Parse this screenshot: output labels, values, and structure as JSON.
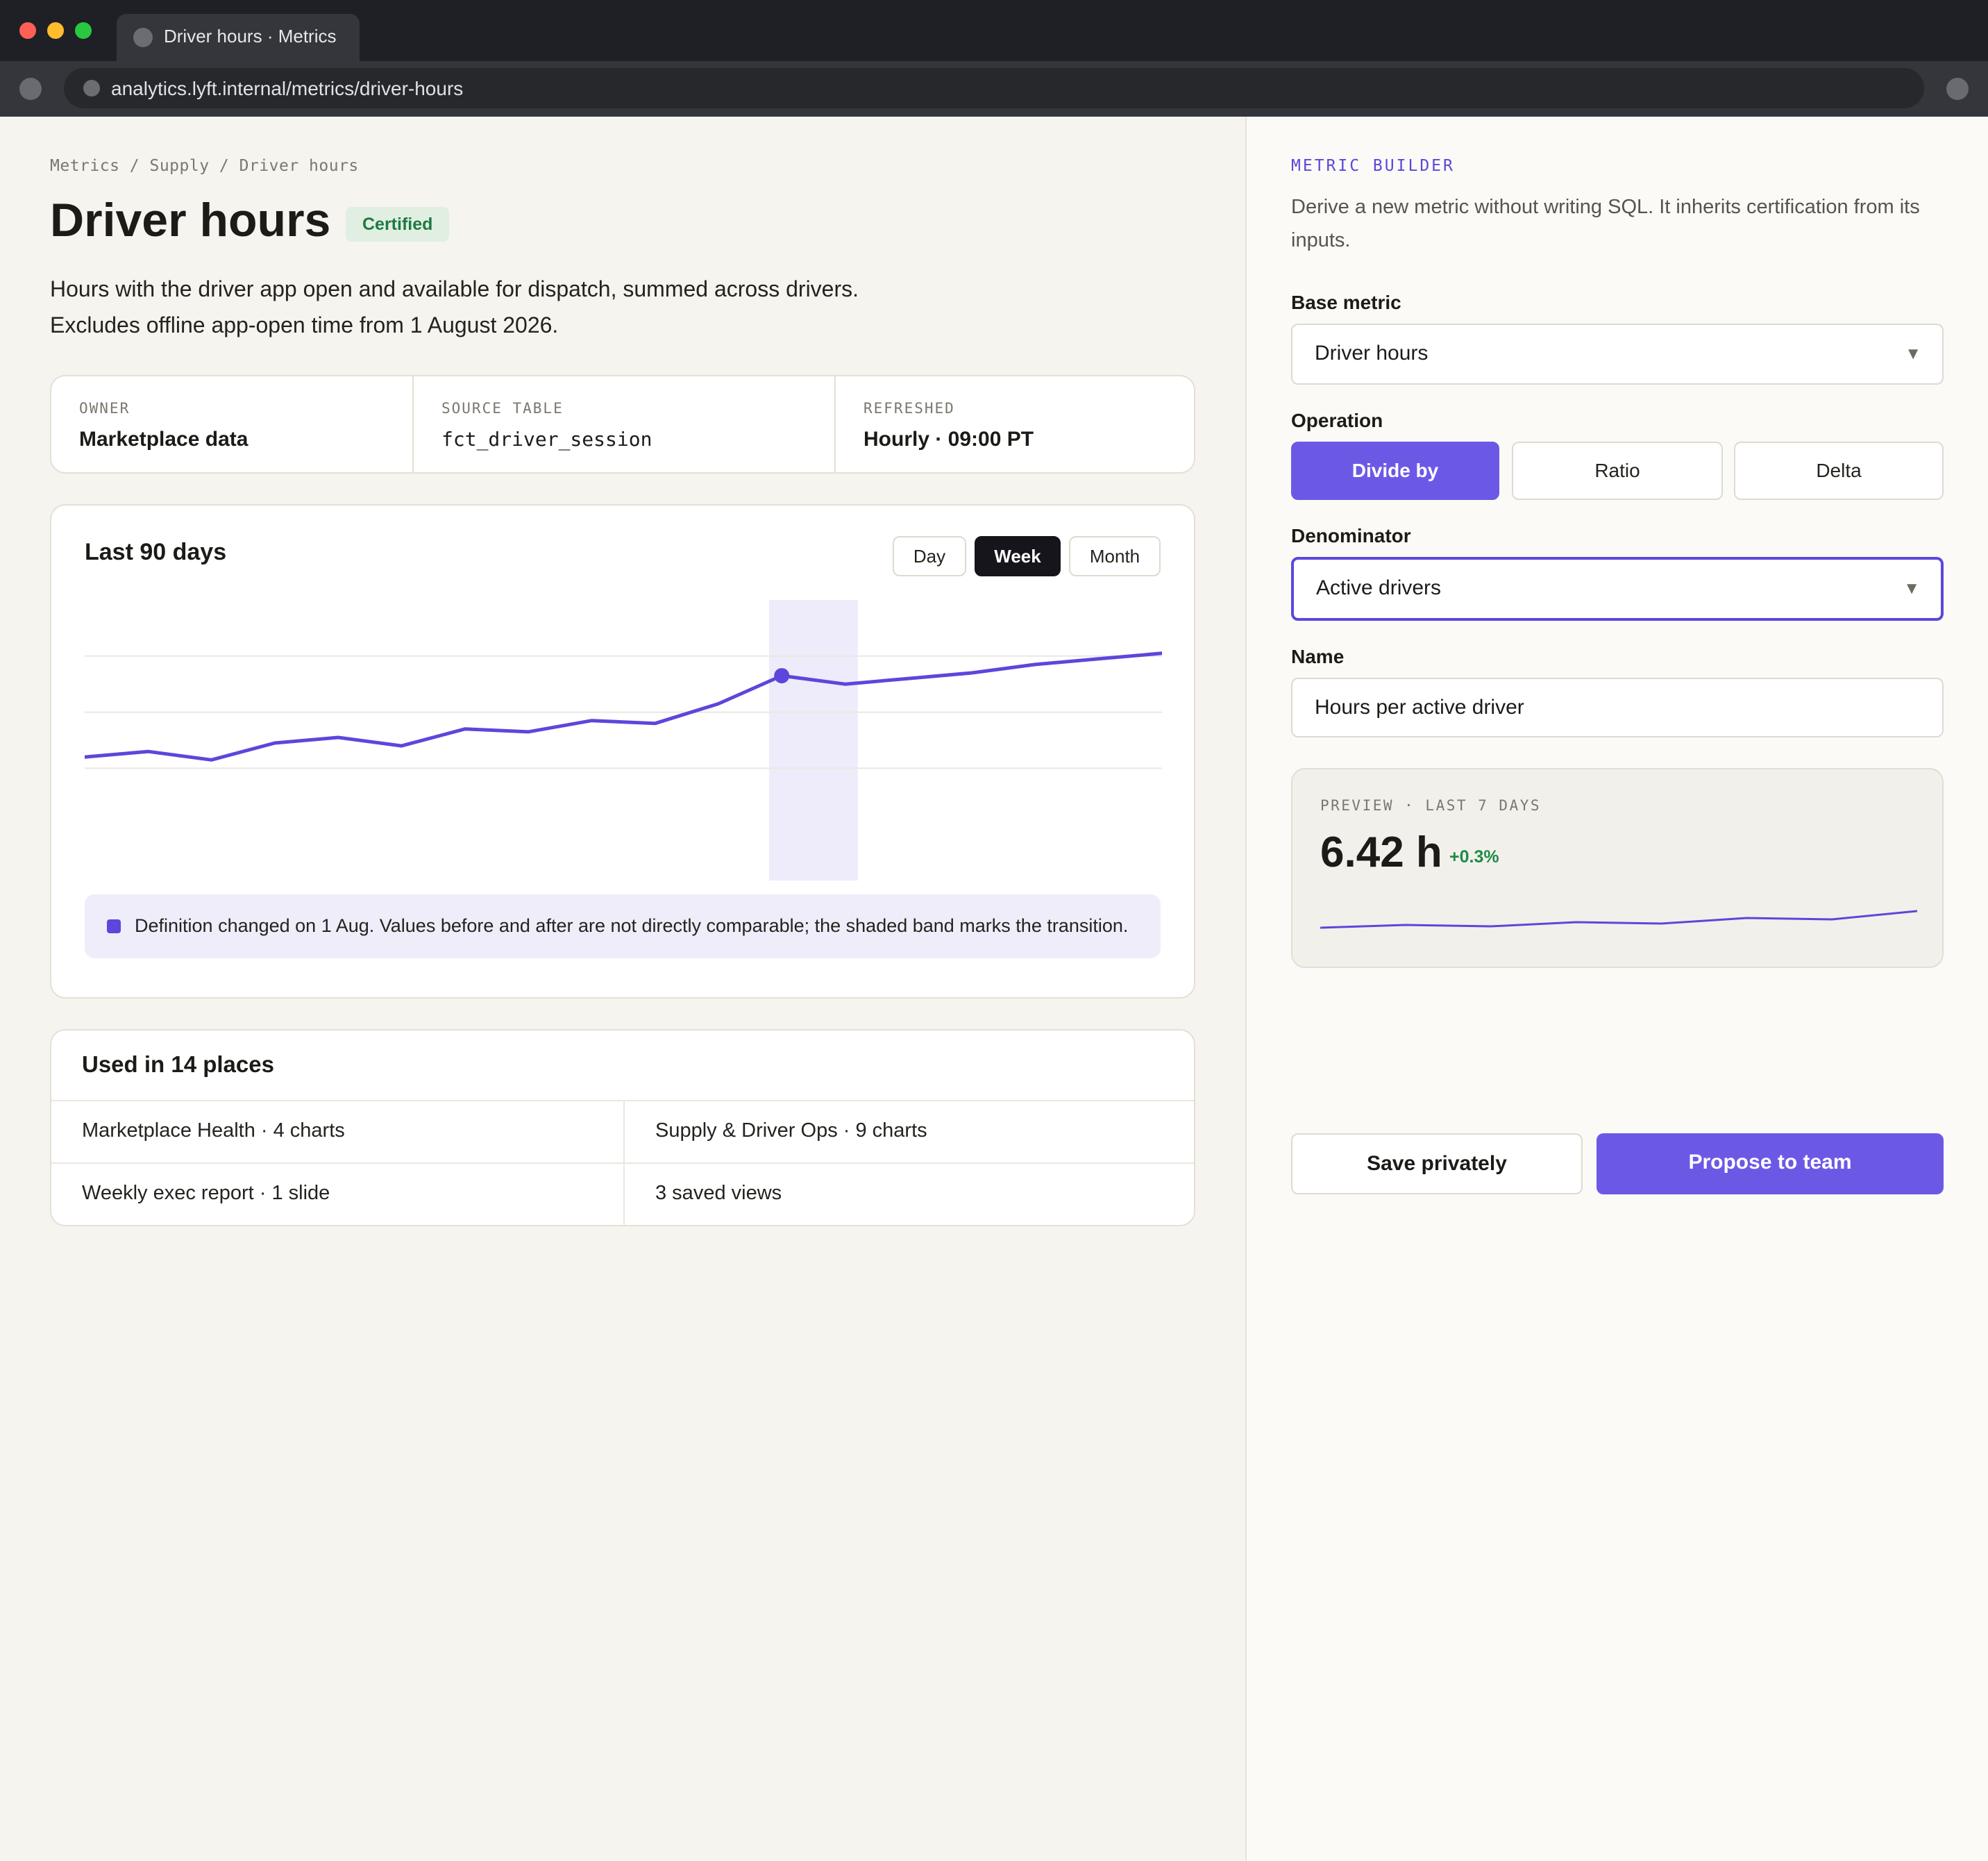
{
  "browser": {
    "tab_title": "Driver hours · Metrics",
    "url": "analytics.lyft.internal/metrics/driver-hours"
  },
  "metric": {
    "breadcrumb": "Metrics / Supply / Driver hours",
    "title": "Driver hours",
    "badge": "Certified",
    "description_lines": [
      "Hours with the driver app open and available for dispatch, summed across drivers.",
      "Excludes offline app-open time from 1 August 2026."
    ]
  },
  "meta": [
    {
      "label": "OWNER",
      "value": "Marketplace data"
    },
    {
      "label": "SOURCE TABLE",
      "value": "fct_driver_session"
    },
    {
      "label": "REFRESHED",
      "value": "Hourly · 09:00 PT"
    }
  ],
  "chart": {
    "title": "Last 90 days",
    "granularity_options": [
      "Day",
      "Week",
      "Month"
    ],
    "selected_granularity": "Week",
    "note": "Definition changed on 1 Aug. Values before and after are not directly comparable; the shaded band marks the transition.",
    "colors": {
      "line": "#5b47dc",
      "band": "#eeebfa",
      "grid": "#ebe8e2"
    }
  },
  "chart_data": {
    "type": "line",
    "title": "Last 90 days",
    "xlabel": "",
    "ylabel": "",
    "x": [
      0,
      1,
      2,
      3,
      4,
      5,
      6,
      7,
      8,
      9,
      10,
      11,
      12,
      13,
      14,
      15,
      16,
      17
    ],
    "values": [
      22,
      23,
      21.5,
      24.5,
      25.5,
      24,
      27,
      26.5,
      28.5,
      28,
      31.5,
      36.5,
      35,
      36,
      37,
      38.5,
      39.5,
      40.5
    ],
    "ylim": [
      0,
      50
    ],
    "highlight_band": [
      10.8,
      12.2
    ],
    "highlight_point_index": 11,
    "grid": true,
    "gridlines": [
      20,
      30,
      40
    ]
  },
  "usage": {
    "title": "Used in 14 places",
    "items": [
      "Marketplace Health · 4 charts",
      "Supply & Driver Ops · 9 charts",
      "Weekly exec report · 1 slide",
      "3 saved views"
    ]
  },
  "builder": {
    "eyebrow": "METRIC BUILDER",
    "description": "Derive a new metric without writing SQL. It inherits certification from its inputs.",
    "base_metric_label": "Base metric",
    "base_metric_value": "Driver hours",
    "operation_label": "Operation",
    "operations": [
      "Divide by",
      "Ratio",
      "Delta"
    ],
    "selected_operation": "Divide by",
    "denominator_label": "Denominator",
    "denominator_value": "Active drivers",
    "name_label": "Name",
    "name_value": "Hours per active driver",
    "preview": {
      "label": "PREVIEW · LAST 7 DAYS",
      "value": "6.42 h",
      "delta": "+0.3%",
      "spark": [
        6.36,
        6.37,
        6.365,
        6.38,
        6.375,
        6.395,
        6.39,
        6.42
      ]
    },
    "save_label": "Save privately",
    "propose_label": "Propose to team"
  }
}
